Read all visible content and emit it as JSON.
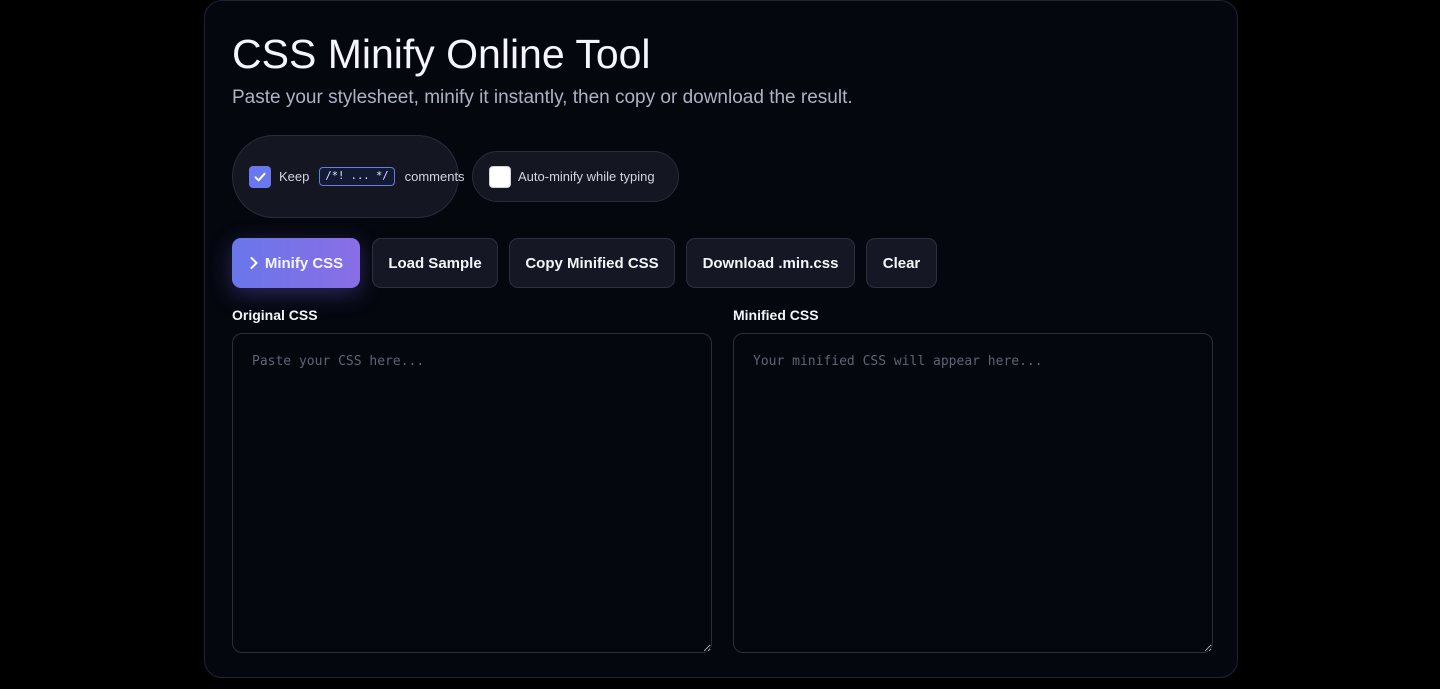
{
  "page": {
    "title": "CSS Minify Online Tool",
    "subtitle": "Paste your stylesheet, minify it instantly, then copy or download the result."
  },
  "options": {
    "keep_comments": {
      "checked": true,
      "label_before": "Keep",
      "code": "/*! ... */",
      "label_after": "comments"
    },
    "auto_minify": {
      "checked": false,
      "label": "Auto-minify while typing"
    }
  },
  "toolbar": {
    "minify_label": "Minify CSS",
    "load_sample_label": "Load Sample",
    "copy_label": "Copy Minified CSS",
    "download_label": "Download .min.css",
    "clear_label": "Clear"
  },
  "panels": {
    "original": {
      "label": "Original CSS",
      "value": "",
      "placeholder": "Paste your CSS here..."
    },
    "minified": {
      "label": "Minified CSS",
      "value": "",
      "placeholder": "Your minified CSS will appear here..."
    }
  },
  "colors": {
    "accent_start": "#6a76ea",
    "accent_end": "#8a6ee6",
    "checkbox_checked": "#6a78f0",
    "card_background": "#05070f"
  }
}
